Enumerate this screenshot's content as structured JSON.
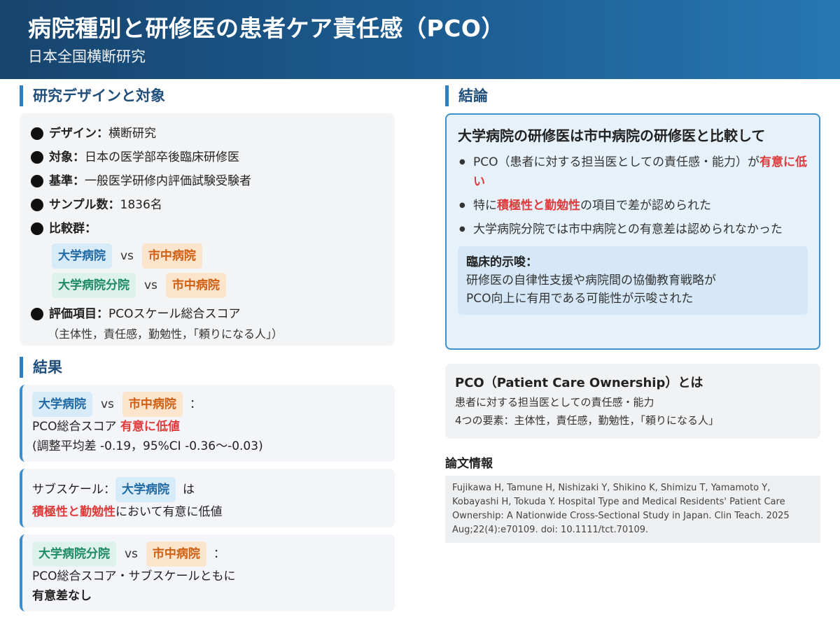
{
  "header": {
    "title": "病院種別と研修医の患者ケア責任感（PCO）",
    "subtitle": "日本全国横断研究"
  },
  "design": {
    "section_title": "研究デザインと対象",
    "design_label": "デザイン：",
    "design_value": "横断研究",
    "subject_label": "対象：",
    "subject_value": "日本の医学部卒後臨床研修医",
    "criteria_label": "基準：",
    "criteria_value": "一般医学研修内評価試験受験者",
    "sample_label": "サンプル数：",
    "sample_value": "1836名",
    "groups_label": "比較群：",
    "compare1_a": "大学病院",
    "compare1_vs": "vs",
    "compare1_b": "市中病院",
    "compare2_a": "大学病院分院",
    "compare2_vs": "vs",
    "compare2_b": "市中病院",
    "eval_label": "評価項目：",
    "eval_value": "PCOスケール総合スコア",
    "eval_note": "（主体性，責任感，勤勉性，「頼りになる人」）"
  },
  "results": {
    "section_title": "結果",
    "card1": {
      "a": "大学病院",
      "vs": "vs",
      "b": "市中病院",
      "colon": "：",
      "line2_prefix": "PCO総合スコア",
      "line2_red": "有意に低値",
      "line3": "(調整平均差 -0.19，95%CI -0.36〜-0.03)"
    },
    "card2": {
      "prefix": "サブスケール：",
      "tag": "大学病院",
      "suffix": "は",
      "red": "積極性と勤勉性",
      "rest": "において有意に低値"
    },
    "card3": {
      "a": "大学病院分院",
      "vs": "vs",
      "b": "市中病院",
      "colon": "：",
      "line2": "PCO総合スコア・サブスケールともに",
      "line3": "有意差なし"
    }
  },
  "conclusion": {
    "section_title": "結論",
    "heading": "大学病院の研修医は市中病院の研修医と比較して",
    "bullet1_prefix": "PCO（患者に対する担当医としての責任感・能力）が",
    "bullet1_red": "有意に低い",
    "bullet2_prefix": "特に",
    "bullet2_red": "積極性と勤勉性",
    "bullet2_suffix": "の項目で差が認められた",
    "bullet3": "大学病院分院では市中病院との有意差は認められなかった",
    "implication_title": "臨床的示唆：",
    "implication_line1": "研修医の自律性支援や病院間の協働教育戦略が",
    "implication_line2": "PCO向上に有用である可能性が示唆された"
  },
  "pco": {
    "title": "PCO（Patient Care Ownership）とは",
    "line1": "患者に対する担当医としての責任感・能力",
    "line2": "4つの要素：主体性，責任感，勤勉性，「頼りになる人」"
  },
  "reference": {
    "title": "論文情報",
    "text": "Fujikawa H, Tamune H, Nishizaki Y, Shikino K, Shimizu T, Yamamoto Y, Kobayashi H, Tokuda Y. Hospital Type and Medical Residents' Patient Care Ownership: A Nationwide Cross-Sectional Study in Japan. Clin Teach. 2025 Aug;22(4):e70109. doi: 10.1111/tct.70109."
  },
  "colors": {
    "header_start": "#17446e",
    "header_end": "#2677b4",
    "accent_blue": "#2f7fc1",
    "highlight_red": "#e03b3b",
    "tag_blue": "#1f6aa5",
    "tag_orange": "#cf5f12",
    "tag_green": "#1f8a67"
  }
}
